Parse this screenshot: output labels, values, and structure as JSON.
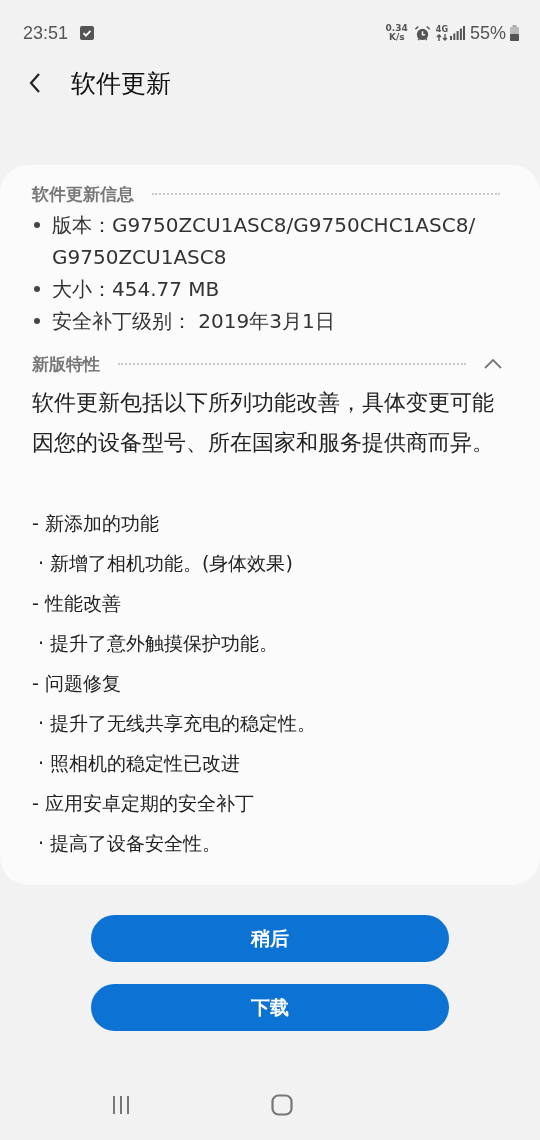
{
  "status_bar": {
    "time": "23:51",
    "net_speed": [
      "0.34",
      "K/s"
    ],
    "network": "4G",
    "battery": "55%"
  },
  "header": {
    "title": "软件更新"
  },
  "info_section": {
    "title": "软件更新信息",
    "items": [
      "版本：G9750ZCU1ASC8/G9750CHC1ASC8/G9750ZCU1ASC8",
      "大小：454.77 MB",
      "安全补丁级别： 2019年3月1日"
    ]
  },
  "features_section": {
    "title": "新版特性",
    "expanded": true,
    "intro": "软件更新包括以下所列功能改善，具体变更可能因您的设备型号、所在国家和服务提供商而异。",
    "lines": [
      {
        "kind": "heading",
        "text": "- 新添加的功能"
      },
      {
        "kind": "item",
        "text": "· 新增了相机功能。(身体效果)"
      },
      {
        "kind": "heading",
        "text": "- 性能改善"
      },
      {
        "kind": "item",
        "text": "· 提升了意外触摸保护功能。"
      },
      {
        "kind": "heading",
        "text": "- 问题修复"
      },
      {
        "kind": "item",
        "text": "· 提升了无线共享充电的稳定性。"
      },
      {
        "kind": "item",
        "text": "· 照相机的稳定性已改进"
      },
      {
        "kind": "heading",
        "text": "- 应用安卓定期的安全补丁"
      },
      {
        "kind": "item",
        "text": "· 提高了设备安全性。"
      }
    ]
  },
  "buttons": [
    "稍后",
    "下载"
  ]
}
